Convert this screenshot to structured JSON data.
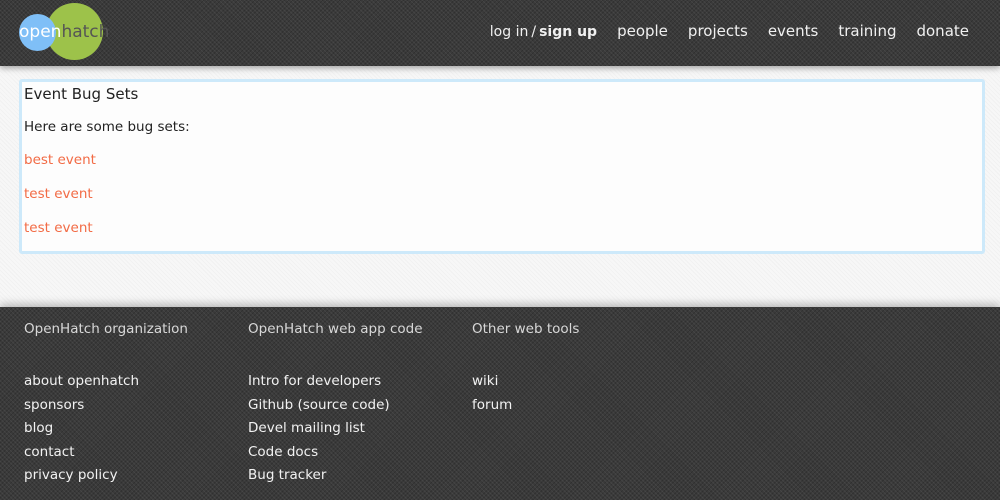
{
  "header": {
    "logo": {
      "part1": "open",
      "part2": "hatch",
      "colors": {
        "blue": "#7fbff7",
        "green": "#9dc24a"
      }
    },
    "auth": {
      "login_label": "log in",
      "separator": "/",
      "signup_label": "sign up"
    },
    "nav": [
      {
        "label": "people"
      },
      {
        "label": "projects"
      },
      {
        "label": "events"
      },
      {
        "label": "training"
      },
      {
        "label": "donate"
      }
    ]
  },
  "main": {
    "title": "Event Bug Sets",
    "intro": "Here are some bug sets:",
    "bug_sets": [
      {
        "label": "best event"
      },
      {
        "label": "test event"
      },
      {
        "label": "test event"
      }
    ],
    "colors": {
      "link": "#f26b45",
      "box_border": "#cde9fa"
    }
  },
  "footer": {
    "columns": [
      {
        "title": "OpenHatch organization",
        "links": [
          "about openhatch",
          "sponsors",
          "blog",
          "contact",
          "privacy policy"
        ]
      },
      {
        "title": "OpenHatch web app code",
        "links": [
          "Intro for developers",
          "Github (source code)",
          "Devel mailing list",
          "Code docs",
          "Bug tracker"
        ]
      },
      {
        "title": "Other web tools",
        "links": [
          "wiki",
          "forum"
        ]
      }
    ]
  }
}
